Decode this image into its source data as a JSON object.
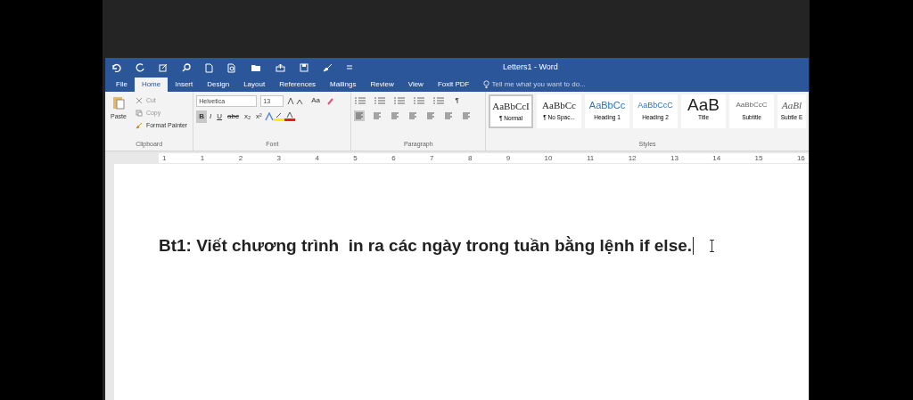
{
  "window": {
    "title": "Letters1 - Word"
  },
  "tabs": [
    {
      "label": "File",
      "selected": false
    },
    {
      "label": "Home",
      "selected": true
    },
    {
      "label": "Insert",
      "selected": false
    },
    {
      "label": "Design",
      "selected": false
    },
    {
      "label": "Layout",
      "selected": false
    },
    {
      "label": "References",
      "selected": false
    },
    {
      "label": "Mailings",
      "selected": false
    },
    {
      "label": "Review",
      "selected": false
    },
    {
      "label": "View",
      "selected": false
    },
    {
      "label": "Foxit PDF",
      "selected": false
    }
  ],
  "tell_me": {
    "placeholder": "Tell me what you want to do..."
  },
  "clipboard": {
    "paste": "Paste",
    "cut": "Cut",
    "copy": "Copy",
    "format_painter": "Format Painter",
    "label": "Clipboard"
  },
  "font": {
    "name": "Helvetica",
    "size": "13",
    "change_case": "Aa",
    "format_buttons": [
      {
        "label": "B",
        "selected": true
      },
      {
        "label": "I",
        "selected": false
      },
      {
        "label": "U",
        "selected": false
      },
      {
        "label": "abc",
        "selected": false
      },
      {
        "label": "x₂",
        "selected": false
      },
      {
        "label": "x²",
        "selected": false
      }
    ],
    "label": "Font"
  },
  "paragraph": {
    "pilcrow": "¶",
    "label": "Paragraph"
  },
  "styles": {
    "items": [
      {
        "preview": "AaBbCcI",
        "name": "¶ Normal",
        "selected": true,
        "kind": "serif"
      },
      {
        "preview": "AaBbCc",
        "name": "¶ No Spac...",
        "selected": false,
        "kind": "serif"
      },
      {
        "preview": "AaBbCc",
        "name": "Heading 1",
        "selected": false,
        "kind": "heading"
      },
      {
        "preview": "AaBbCcC",
        "name": "Heading 2",
        "selected": false,
        "kind": "heading2"
      },
      {
        "preview": "AaB",
        "name": "Title",
        "selected": false,
        "kind": "title"
      },
      {
        "preview": "AaBbCcC",
        "name": "Subtitle",
        "selected": false,
        "kind": "subtitle"
      },
      {
        "preview": "AaBl",
        "name": "Subtle E",
        "selected": false,
        "kind": "emphasis"
      }
    ],
    "label": "Styles"
  },
  "ruler": [
    "1",
    "1",
    "2",
    "3",
    "4",
    "5",
    "6",
    "7",
    "8",
    "9",
    "10",
    "11",
    "12",
    "13",
    "14",
    "15",
    "16"
  ],
  "document": {
    "text": "Bt1: Viết chương trình  in ra các ngày trong tuần bằng lệnh if else."
  }
}
